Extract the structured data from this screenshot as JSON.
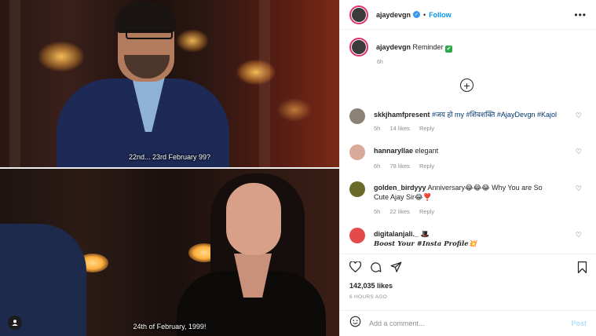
{
  "media": {
    "subtitle_top": "22nd... 23rd February 99?",
    "subtitle_bottom": "24th of February, 1999!"
  },
  "header": {
    "username": "ajaydevgn",
    "follow_label": "Follow",
    "separator": "•",
    "more_label": "•••"
  },
  "caption": {
    "username": "ajaydevgn",
    "text": "Reminder",
    "emoji": "✔",
    "age": "6h"
  },
  "comments": [
    {
      "username": "skkjhamfpresent",
      "text": "#जय हो my #शिवशक्ति #AjayDevgn #Kajol",
      "age": "5h",
      "likes": "14 likes",
      "reply": "Reply",
      "avatar_color": "#8b8276"
    },
    {
      "username": "hannaryllae",
      "text": "elegant",
      "age": "6h",
      "likes": "78 likes",
      "reply": "Reply",
      "avatar_color": "#d9a99b"
    },
    {
      "username": "golden_birdyyy",
      "text": "Anniversary😂😂😂 Why You are So Cute Ajay Sir😂❣️",
      "age": "5h",
      "likes": "22 likes",
      "reply": "Reply",
      "avatar_color": "#6a6a2a"
    },
    {
      "username": "digitalanjali._",
      "badge": "🎩",
      "text": "Boost Your #Insta Profile💥",
      "avatar_color": "#e34b4b"
    }
  ],
  "stats": {
    "likes": "142,035 likes",
    "posted": "6 HOURS AGO"
  },
  "add_comment": {
    "placeholder": "Add a comment...",
    "post_label": "Post"
  },
  "colors": {
    "accent": "#0095f6",
    "verified": "#3897f0",
    "muted": "#8e8e8e",
    "text": "#262626"
  }
}
